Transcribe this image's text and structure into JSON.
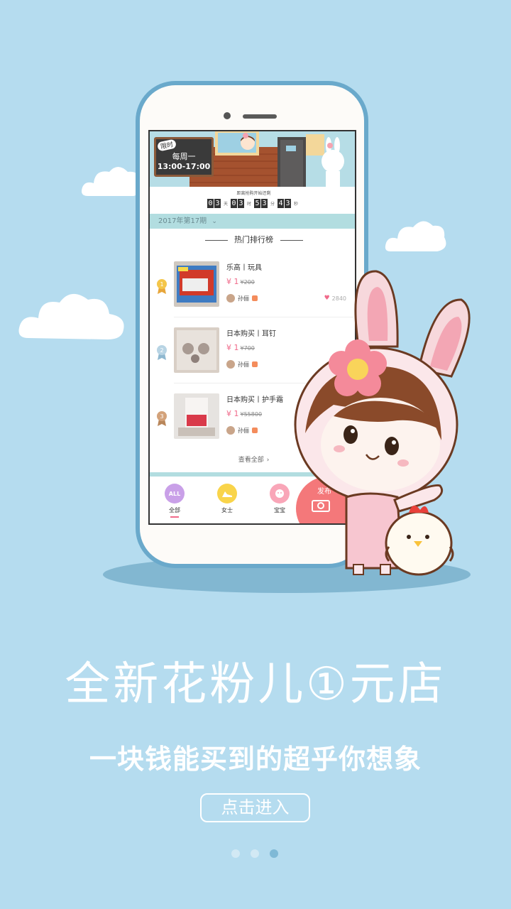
{
  "banner": {
    "tag": "限时",
    "schedule_day": "每周一",
    "schedule_time": "13:00-17:00"
  },
  "countdown": {
    "title": "距离抢购开始还剩",
    "days": [
      "0",
      "3"
    ],
    "hours": [
      "0",
      "3"
    ],
    "minutes": [
      "5",
      "3"
    ],
    "seconds": [
      "4",
      "3"
    ],
    "unit_day": "天",
    "unit_hour": "时",
    "unit_minute": "分",
    "unit_second": "秒"
  },
  "period": {
    "label": "2017年第17期"
  },
  "ranking": {
    "title": "热门排行榜",
    "items": [
      {
        "rank": "1",
        "title": "乐高丨玩具",
        "price": "¥ 1",
        "original": "¥200",
        "user": "孙俪",
        "likes": "2840"
      },
      {
        "rank": "2",
        "title": "日本购买丨耳钉",
        "price": "¥ 1",
        "original": "¥700",
        "user": "孙俪",
        "likes": ""
      },
      {
        "rank": "3",
        "title": "日本购买丨护手霜",
        "price": "¥ 1",
        "original": "¥55800",
        "user": "孙俪",
        "likes": ""
      }
    ],
    "more": "查看全部"
  },
  "tabs": [
    {
      "label": "全部",
      "icon_text": "ALL",
      "color": "#c9a0e8"
    },
    {
      "label": "女士",
      "icon_text": "",
      "color": "#f9d44a"
    },
    {
      "label": "宝宝",
      "icon_text": "",
      "color": "#f9a6b8"
    }
  ],
  "publish": {
    "label": "发布"
  },
  "hero": {
    "headline": "全新花粉儿①元店",
    "subtitle": "一块钱能买到的超乎你想象",
    "enter_button": "点击进入"
  },
  "colors": {
    "background": "#b5dcef",
    "accent_pink": "#f06a8a",
    "teal_bar": "#b2dde0"
  },
  "pagination": {
    "count": 3,
    "active": 3
  }
}
